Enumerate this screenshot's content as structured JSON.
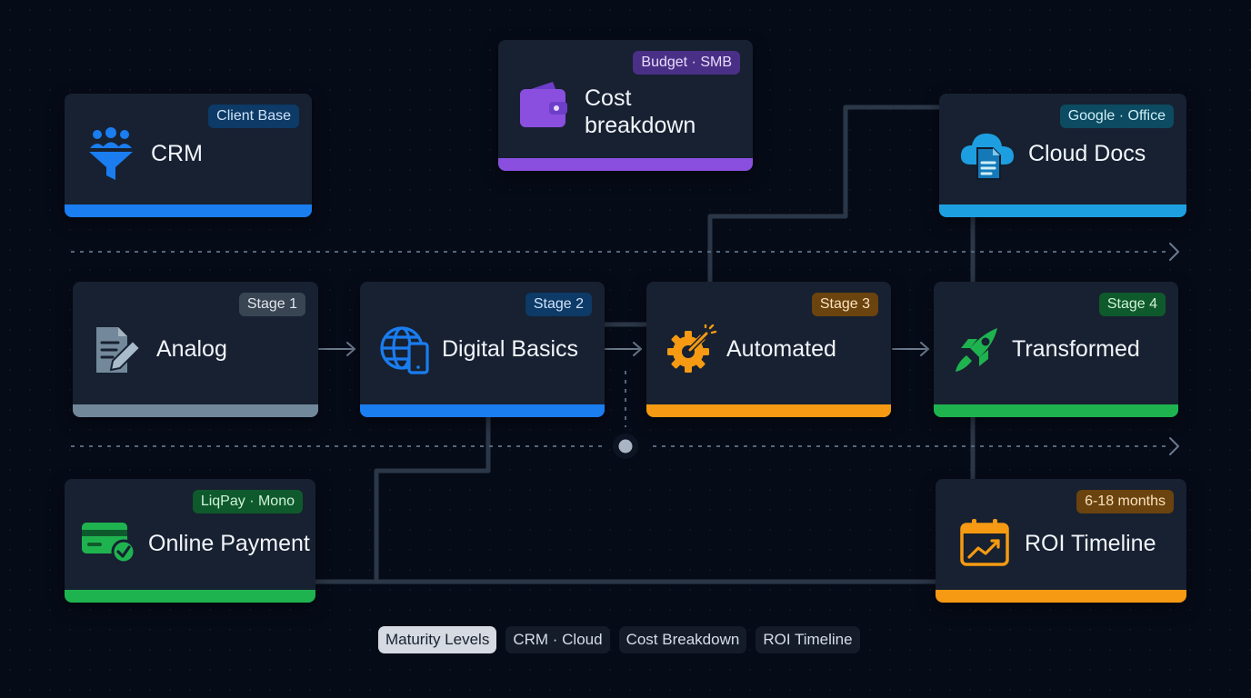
{
  "cards": {
    "crm": {
      "title": "CRM",
      "badge": "Client Base",
      "icon": "funnel-people-icon",
      "accent": "#1a7df0"
    },
    "cost": {
      "title": "Cost breakdown",
      "badge": "Budget · SMB",
      "icon": "wallet-icon",
      "accent": "#8b4fe0"
    },
    "cloud": {
      "title": "Cloud Docs",
      "badge": "Google · Office",
      "icon": "cloud-document-icon",
      "accent": "#1da0e0"
    },
    "analog": {
      "title": "Analog",
      "badge": "Stage 1",
      "icon": "document-pencil-icon",
      "accent": "#71889a"
    },
    "digital": {
      "title": "Digital Basics",
      "badge": "Stage 2",
      "icon": "globe-phone-icon",
      "accent": "#1a7df0"
    },
    "automated": {
      "title": "Automated",
      "badge": "Stage 3",
      "icon": "gear-wrench-icon",
      "accent": "#f59a12"
    },
    "transformed": {
      "title": "Transformed",
      "badge": "Stage 4",
      "icon": "rocket-icon",
      "accent": "#1fb34f"
    },
    "payment": {
      "title": "Online Payment",
      "badge": "LiqPay · Mono",
      "icon": "card-check-icon",
      "accent": "#1fb34f"
    },
    "roi": {
      "title": "ROI Timeline",
      "badge": "6-18 months",
      "icon": "calendar-chart-icon",
      "accent": "#f59a12"
    }
  },
  "tabs": [
    "Maturity Levels",
    "CRM · Cloud",
    "Cost Breakdown",
    "ROI Timeline"
  ],
  "active_tab": "Maturity Levels"
}
